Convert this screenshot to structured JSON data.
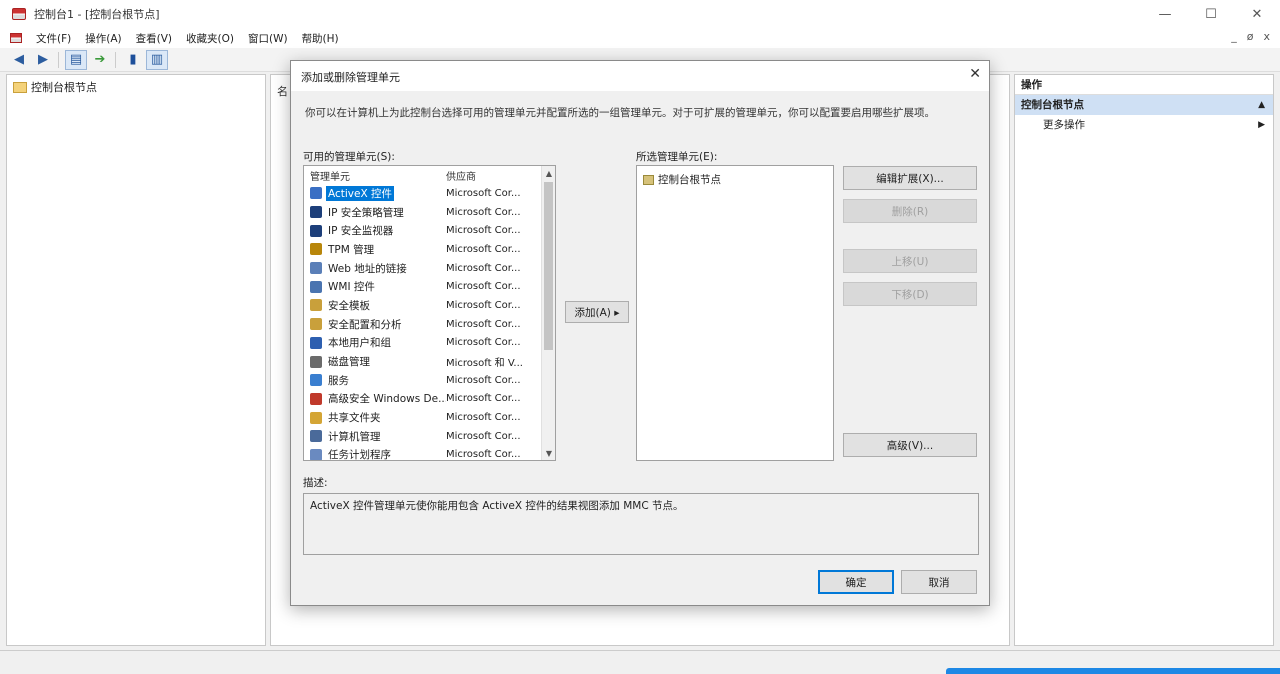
{
  "window": {
    "title": "控制台1 - [控制台根节点]",
    "minimize": "—",
    "maximize": "☐",
    "close": "✕"
  },
  "menubar": {
    "items": [
      "文件(F)",
      "操作(A)",
      "查看(V)",
      "收藏夹(O)",
      "窗口(W)",
      "帮助(H)"
    ],
    "mdi": [
      "_",
      "ø",
      "x"
    ]
  },
  "toolbar": {
    "icons": [
      "back-arrow-icon",
      "forward-arrow-icon",
      "show-tree-icon",
      "export-icon",
      "help-icon",
      "action-pane-icon"
    ]
  },
  "tree": {
    "root": "控制台根节点"
  },
  "center": {
    "header": "名"
  },
  "actions": {
    "title": "操作",
    "section": "控制台根节点",
    "more": "更多操作"
  },
  "dialog": {
    "title": "添加或删除管理单元",
    "close": "✕",
    "description": "你可以在计算机上为此控制台选择可用的管理单元并配置所选的一组管理单元。对于可扩展的管理单元，你可以配置要启用哪些扩展项。",
    "available_label": "可用的管理单元(S):",
    "selected_label": "所选管理单元(E):",
    "columns": {
      "name": "管理单元",
      "vendor": "供应商"
    },
    "snapins": [
      {
        "name": "ActiveX 控件",
        "vendor": "Microsoft Cor...",
        "icon_color": "#3a6fc4"
      },
      {
        "name": "IP 安全策略管理",
        "vendor": "Microsoft Cor...",
        "icon_color": "#1d3f7a"
      },
      {
        "name": "IP 安全监视器",
        "vendor": "Microsoft Cor...",
        "icon_color": "#1d3f7a"
      },
      {
        "name": "TPM 管理",
        "vendor": "Microsoft Cor...",
        "icon_color": "#b8860b"
      },
      {
        "name": "Web 地址的链接",
        "vendor": "Microsoft Cor...",
        "icon_color": "#5a7fb8"
      },
      {
        "name": "WMI 控件",
        "vendor": "Microsoft Cor...",
        "icon_color": "#4a74b0"
      },
      {
        "name": "安全模板",
        "vendor": "Microsoft Cor...",
        "icon_color": "#c9a03b"
      },
      {
        "name": "安全配置和分析",
        "vendor": "Microsoft Cor...",
        "icon_color": "#c9a03b"
      },
      {
        "name": "本地用户和组",
        "vendor": "Microsoft Cor...",
        "icon_color": "#2d5fb0"
      },
      {
        "name": "磁盘管理",
        "vendor": "Microsoft 和 V...",
        "icon_color": "#6b6b6b"
      },
      {
        "name": "服务",
        "vendor": "Microsoft Cor...",
        "icon_color": "#3a7fd0"
      },
      {
        "name": "高级安全 Windows De...",
        "vendor": "Microsoft Cor...",
        "icon_color": "#c0392b"
      },
      {
        "name": "共享文件夹",
        "vendor": "Microsoft Cor...",
        "icon_color": "#d4a535"
      },
      {
        "name": "计算机管理",
        "vendor": "Microsoft Cor...",
        "icon_color": "#4a6a9a"
      },
      {
        "name": "任务计划程序",
        "vendor": "Microsoft Cor...",
        "icon_color": "#6a8ac0"
      }
    ],
    "add_button": "添加(A) ▸",
    "selected_items": [
      "控制台根节点"
    ],
    "buttons": {
      "edit_extensions": "编辑扩展(X)...",
      "remove": "删除(R)",
      "move_up": "上移(U)",
      "move_down": "下移(D)",
      "advanced": "高级(V)..."
    },
    "desc_label": "描述:",
    "desc_text": "ActiveX 控件管理单元使你能用包含 ActiveX 控件的结果视图添加 MMC 节点。",
    "ok": "确定",
    "cancel": "取消"
  }
}
